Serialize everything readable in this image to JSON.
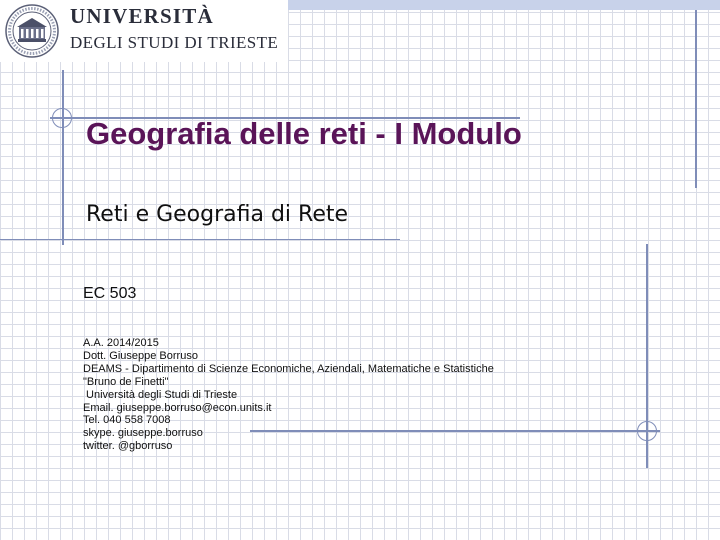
{
  "header": {
    "university_line1": "UNIVERSITÀ",
    "university_line2": "DEGLI STUDI DI TRIESTE",
    "seal_icon": "university-seal-icon"
  },
  "slide": {
    "title": "Geografia delle reti - I Modulo",
    "subtitle": "Reti e Geografia di Rete",
    "course_code": "EC 503",
    "details": [
      "A.A. 2014/2015",
      "Dott. Giuseppe Borruso",
      "DEAMS - Dipartimento di Scienze Economiche, Aziendali, Matematiche e Statistiche",
      "\"Bruno de Finetti\"",
      " Università degli Studi di Trieste",
      "Email. giuseppe.borruso@econ.units.it",
      "Tel. 040 558 7008",
      "skype. giuseppe.borruso",
      "twitter. @gborruso"
    ]
  },
  "colors": {
    "title": "#5a1458",
    "accent_lines": "#7f8db8",
    "grid": "#d9dce6"
  }
}
